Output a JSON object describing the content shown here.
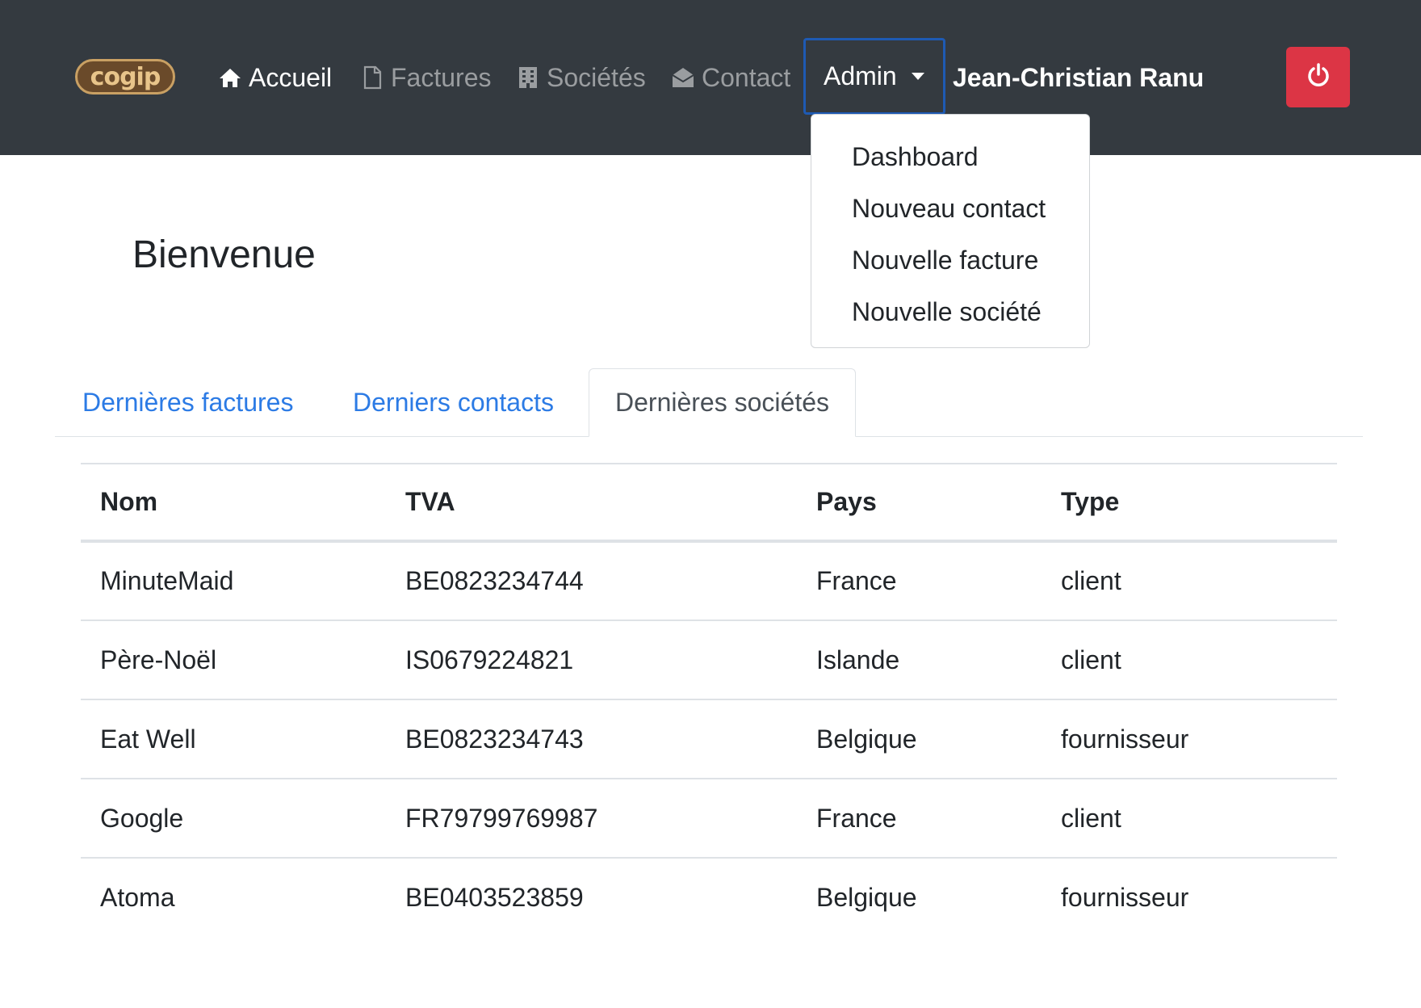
{
  "navbar": {
    "logo_text": "cogip",
    "items": [
      {
        "label": "Accueil",
        "icon": "home-icon"
      },
      {
        "label": "Factures",
        "icon": "file-icon"
      },
      {
        "label": "Sociétés",
        "icon": "building-icon"
      },
      {
        "label": "Contact",
        "icon": "envelope-open-icon"
      }
    ],
    "admin_label": "Admin",
    "user_name": "Jean-Christian Ranu",
    "logout_icon": "power-icon"
  },
  "admin_menu": {
    "items": [
      "Dashboard",
      "Nouveau contact",
      "Nouvelle facture",
      "Nouvelle société"
    ]
  },
  "page": {
    "title": "Bienvenue"
  },
  "tabs": {
    "items": [
      "Dernières factures",
      "Derniers contacts",
      "Dernières sociétés"
    ],
    "active": "Dernières sociétés"
  },
  "table": {
    "headers": [
      "Nom",
      "TVA",
      "Pays",
      "Type"
    ],
    "rows": [
      [
        "MinuteMaid",
        "BE0823234744",
        "France",
        "client"
      ],
      [
        "Père-Noël",
        "IS0679224821",
        "Islande",
        "client"
      ],
      [
        "Eat Well",
        "BE0823234743",
        "Belgique",
        "fournisseur"
      ],
      [
        "Google",
        "FR79799769987",
        "France",
        "client"
      ],
      [
        "Atoma",
        "BE0403523859",
        "Belgique",
        "fournisseur"
      ]
    ]
  },
  "colors": {
    "navbar_bg": "#343a40",
    "link_blue": "#2c7be5",
    "danger": "#dc3545",
    "focus_border": "#1e5ab3"
  }
}
